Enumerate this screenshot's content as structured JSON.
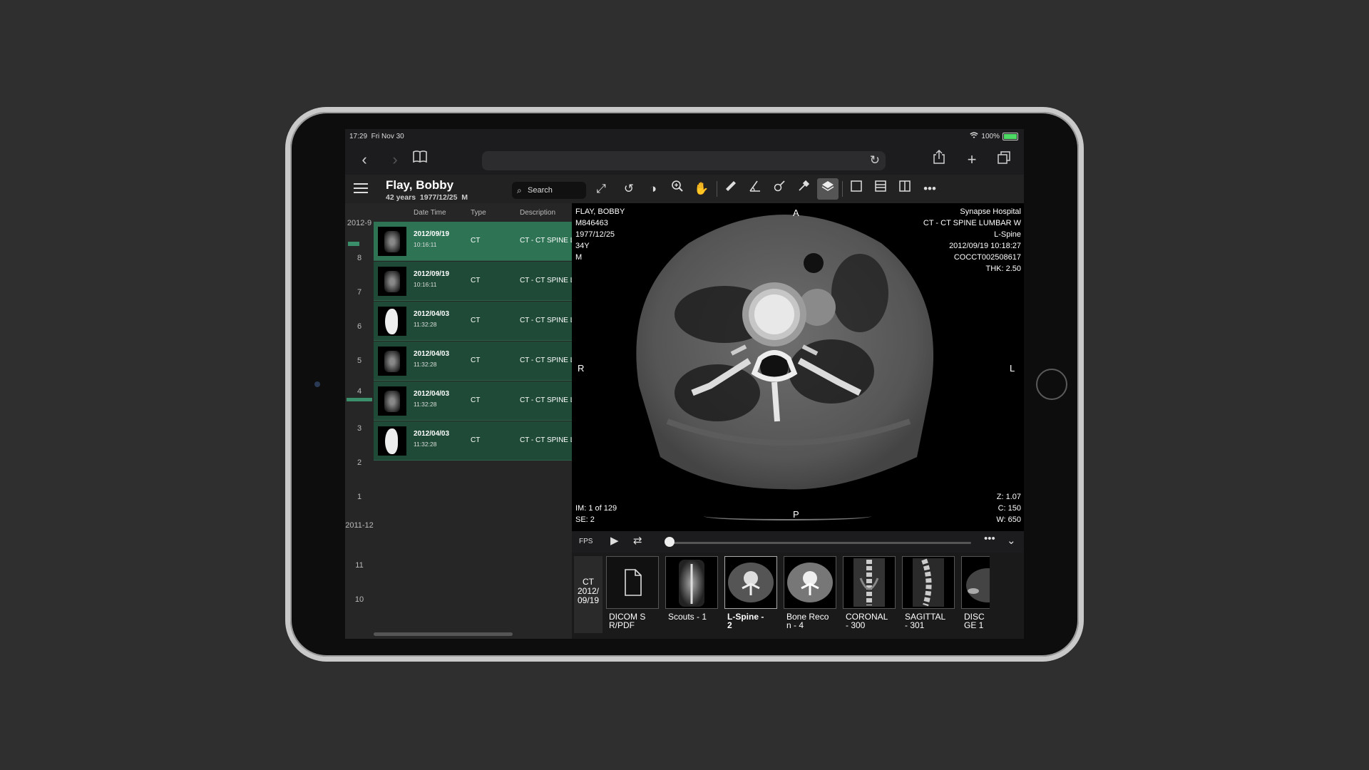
{
  "status": {
    "time": "17:29",
    "date": "Fri Nov 30",
    "battery": "100%"
  },
  "patient": {
    "name": "Flay, Bobby",
    "age": "42 years",
    "dob": "1977/12/25",
    "sex": "M"
  },
  "search": {
    "label": "Search"
  },
  "timeline": [
    {
      "label": "2012-9",
      "marked": true
    },
    {
      "label": "8"
    },
    {
      "label": "7"
    },
    {
      "label": "6"
    },
    {
      "label": "5"
    },
    {
      "label": "4",
      "marked": true
    },
    {
      "label": "3"
    },
    {
      "label": "2"
    },
    {
      "label": "1"
    },
    {
      "label": "2011-12"
    },
    {
      "label": "11"
    },
    {
      "label": "10"
    }
  ],
  "list": {
    "columns": [
      "Date Time",
      "Type",
      "Description"
    ],
    "rows": [
      {
        "date": "2012/09/19",
        "time": "10:16:11",
        "type": "CT",
        "desc": "CT - CT SPINE LUMBAR W",
        "thumb": "xray",
        "selected": true
      },
      {
        "date": "2012/09/19",
        "time": "10:16:11",
        "type": "CT",
        "desc": "CT - CT SPINE LUMBAR W",
        "thumb": "xray"
      },
      {
        "date": "2012/04/03",
        "time": "11:32:28",
        "type": "CT",
        "desc": "CT - CT SPINE LUMBAR W",
        "thumb": "mri"
      },
      {
        "date": "2012/04/03",
        "time": "11:32:28",
        "type": "CT",
        "desc": "CT - CT SPINE LUMBAR W",
        "thumb": "xray"
      },
      {
        "date": "2012/04/03",
        "time": "11:32:28",
        "type": "CT",
        "desc": "CT - CT SPINE LUMBAR W",
        "thumb": "xray"
      },
      {
        "date": "2012/04/03",
        "time": "11:32:28",
        "type": "CT",
        "desc": "CT - CT SPINE LUMBAR W",
        "thumb": "mri"
      }
    ]
  },
  "viewer": {
    "top_left": [
      "FLAY, BOBBY",
      "M846463",
      "1977/12/25",
      "34Y",
      "M"
    ],
    "top_right": [
      "Synapse Hospital",
      "CT - CT SPINE LUMBAR W",
      "L-Spine",
      "2012/09/19 10:18:27",
      "COCCT002508617",
      "THK: 2.50"
    ],
    "bottom_left": [
      "IM: 1 of 129",
      "SE: 2"
    ],
    "bottom_right": [
      "Z: 1.07",
      "C: 150",
      "W: 650"
    ],
    "orientation": {
      "top": "A",
      "bottom": "P",
      "left": "R",
      "right": "L"
    }
  },
  "playback": {
    "fps_label": "FPS",
    "position": 0.0
  },
  "strip": {
    "study_tag": [
      "CT",
      "2012/",
      "09/19"
    ],
    "series": [
      {
        "label_1": "DICOM S",
        "label_2": "R/PDF",
        "kind": "doc"
      },
      {
        "label_1": "Scouts - 1",
        "label_2": "",
        "kind": "scout"
      },
      {
        "label_1": "L-Spine -",
        "label_2": "2",
        "kind": "axial",
        "selected": true
      },
      {
        "label_1": "Bone Reco",
        "label_2": "n - 4",
        "kind": "bone"
      },
      {
        "label_1": "CORONAL",
        "label_2": "- 300",
        "kind": "coronal"
      },
      {
        "label_1": "SAGITTAL",
        "label_2": "- 301",
        "kind": "sagittal"
      },
      {
        "label_1": "DISC",
        "label_2": "GE 1",
        "kind": "disc"
      }
    ]
  }
}
